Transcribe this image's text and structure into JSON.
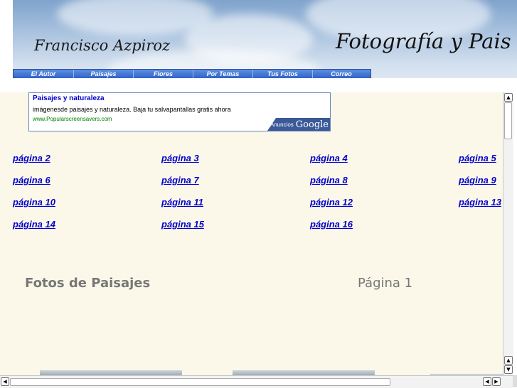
{
  "header": {
    "author": "Francisco Azpiroz",
    "site_title": "Fotografía y Pais"
  },
  "nav": {
    "items": [
      "El Autor",
      "Paisajes",
      "Flores",
      "Por Temas",
      "Tus Fotos",
      "Correo"
    ]
  },
  "ad": {
    "title": "Paisajes y naturaleza",
    "text": "imágenesde paisajes y naturaleza. Baja tu salvapantallas gratis ahora",
    "url": "www.Popularscreensavers.com",
    "badge_prefix": "Anuncios",
    "badge_brand": "Google"
  },
  "pages": {
    "links": [
      "página 2",
      "página 3",
      "página 4",
      "página 5",
      "página 6",
      "página 7",
      "página 8",
      "página 9",
      "página 10",
      "página 11",
      "página 12",
      "página 13",
      "página 14",
      "página 15",
      "página 16"
    ]
  },
  "main": {
    "section_title": "Fotos de Paisajes",
    "page_label": "Página 1"
  },
  "colors": {
    "link": "#0000cc",
    "nav_bg": "#3a6fd6",
    "content_bg": "#fbf8e9"
  }
}
